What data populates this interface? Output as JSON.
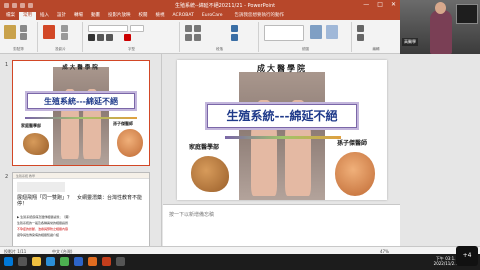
{
  "window": {
    "title": "生殖系統--綿延不絕20211/21 - PowerPoint",
    "controls": [
      "—",
      "□",
      "✕"
    ]
  },
  "ribbon_tabs": [
    {
      "label": "檔案",
      "active": false
    },
    {
      "label": "常用",
      "active": true
    },
    {
      "label": "插入",
      "active": false
    },
    {
      "label": "設計",
      "active": false
    },
    {
      "label": "轉場",
      "active": false
    },
    {
      "label": "動畫",
      "active": false
    },
    {
      "label": "投影片放映",
      "active": false
    },
    {
      "label": "校閱",
      "active": false
    },
    {
      "label": "檢視",
      "active": false
    },
    {
      "label": "ACROBAT",
      "active": false
    },
    {
      "label": "EuroCare",
      "active": false
    }
  ],
  "ribbon_search": "告訴我您想要執行的動作",
  "ribbon_groups": [
    "剪貼簿",
    "投影片",
    "字型",
    "段落",
    "繪圖",
    "編輯"
  ],
  "presenter": {
    "name": "高醫學"
  },
  "slide_numbers": [
    "1",
    "2"
  ],
  "slide1": {
    "top_title": "成大醫學院",
    "banner": "生殖系統---綿延不絕",
    "label_left": "家庭醫學部",
    "label_right": "孫子傑醫師"
  },
  "slide2": {
    "header_left": "生殖系統 教學",
    "heading": "展翅飛翔「同一雙跑」？　女網靈潛藥：台灣性教育不能停！",
    "lines": [
      "▶ 生殖系統疾病及遺傳相關議題；（圖）",
      "生殖系統的一般及各種異常的相關議題",
      "不孕症的診斷、治療與預防之相關內容",
      "避孕與性傳染病的相關知識介紹"
    ]
  },
  "notes_placeholder": "按一下以新增備忘稿",
  "status": {
    "slide_info": "投影片 1/11",
    "language": "中文 (台灣)",
    "zoom": "47%"
  },
  "taskbar": {
    "time": "下午 03:1...",
    "date": "2022/11/2..."
  },
  "participants_badge": "+4",
  "colors": {
    "accent": "#b7472a",
    "banner_text": "#1f3a8a",
    "banner_border": "#7b67a8"
  }
}
